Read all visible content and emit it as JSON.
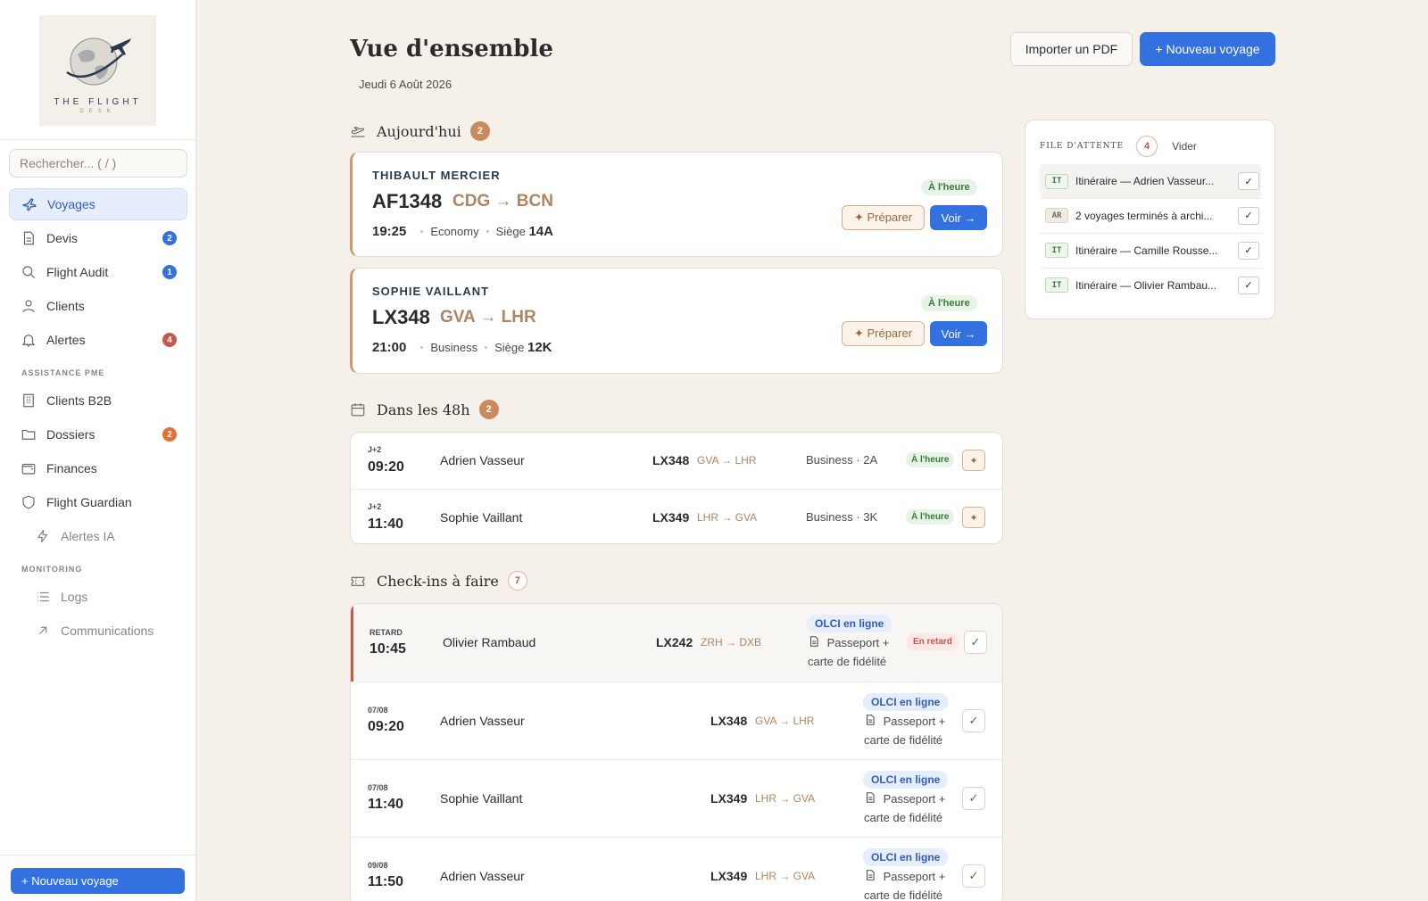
{
  "sidebar": {
    "logo": {
      "word1": "THE FLIGHT",
      "word2": "DESK"
    },
    "search_placeholder": "Rechercher...  ( / )",
    "nav": [
      {
        "label": "Voyages",
        "icon": "plane-icon",
        "badge": ""
      },
      {
        "label": "Devis",
        "icon": "document-icon",
        "badge": "2"
      },
      {
        "label": "Flight Audit",
        "icon": "search-icon",
        "badge": "1"
      },
      {
        "label": "Clients",
        "icon": "user-icon",
        "badge": ""
      },
      {
        "label": "Alertes",
        "icon": "bell-icon",
        "badge": "4"
      }
    ],
    "section_assistance": "ASSISTANCE PME",
    "nav2": [
      {
        "label": "Clients B2B",
        "icon": "building-icon",
        "badge": ""
      },
      {
        "label": "Dossiers",
        "icon": "folder-icon",
        "badge": "2"
      },
      {
        "label": "Finances",
        "icon": "wallet-icon",
        "badge": ""
      },
      {
        "label": "Flight Guardian",
        "icon": "shield-icon",
        "badge": ""
      },
      {
        "label": "Alertes IA",
        "icon": "bolt-icon",
        "badge": ""
      }
    ],
    "section_monitoring": "MONITORING",
    "nav3": [
      {
        "label": "Logs",
        "icon": "list-icon"
      },
      {
        "label": "Communications",
        "icon": "arrow-up-right-icon"
      }
    ],
    "footer_button": "+ Nouveau voyage"
  },
  "header": {
    "title": "Vue d'ensemble",
    "date": "Jeudi 6 Août 2026",
    "import_button": "Importer un PDF",
    "new_button": "+ Nouveau voyage"
  },
  "today": {
    "title": "Aujourd'hui",
    "count": "2",
    "flights": [
      {
        "passenger": "THIBAULT MERCIER",
        "flight": "AF1348",
        "route": "CDG → BCN",
        "time": "19:25",
        "cabin": "Economy",
        "seat_label": "Siège",
        "seat": "14A",
        "status": "À l'heure",
        "prepare": "✦ Préparer",
        "view": "Voir →"
      },
      {
        "passenger": "SOPHIE VAILLANT",
        "flight": "LX348",
        "route": "GVA → LHR",
        "time": "21:00",
        "cabin": "Business",
        "seat_label": "Siège",
        "seat": "12K",
        "status": "À l'heure",
        "prepare": "✦ Préparer",
        "view": "Voir →"
      }
    ]
  },
  "next48": {
    "title": "Dans les 48h",
    "count": "2",
    "rows": [
      {
        "day": "J+2",
        "time": "09:20",
        "name": "Adrien Vasseur",
        "flight": "LX348",
        "route": "GVA → LHR",
        "cabin": "Business · 2A",
        "status": "À l'heure",
        "action": "✦"
      },
      {
        "day": "J+2",
        "time": "11:40",
        "name": "Sophie Vaillant",
        "flight": "LX349",
        "route": "LHR → GVA",
        "cabin": "Business · 3K",
        "status": "À l'heure",
        "action": "✦"
      }
    ]
  },
  "checkins": {
    "title": "Check-ins à faire",
    "count": "7",
    "rows": [
      {
        "day": "RETARD",
        "time": "10:45",
        "name": "Olivier Rambaud",
        "flight": "LX242",
        "route": "ZRH → DXB",
        "olci": "OLCI en ligne",
        "doc1": "Passeport +",
        "doc2": "carte de fidélité",
        "late": "En retard",
        "check": "✓"
      },
      {
        "day": "07/08",
        "time": "09:20",
        "name": "Adrien Vasseur",
        "flight": "LX348",
        "route": "GVA → LHR",
        "olci": "OLCI en ligne",
        "doc1": "Passeport +",
        "doc2": "carte de fidélité",
        "check": "✓"
      },
      {
        "day": "07/08",
        "time": "11:40",
        "name": "Sophie Vaillant",
        "flight": "LX349",
        "route": "LHR → GVA",
        "olci": "OLCI en ligne",
        "doc1": "Passeport +",
        "doc2": "carte de fidélité",
        "check": "✓"
      },
      {
        "day": "09/08",
        "time": "11:50",
        "name": "Adrien Vasseur",
        "flight": "LX349",
        "route": "LHR → GVA",
        "olci": "OLCI en ligne",
        "doc1": "Passeport +",
        "doc2": "carte de fidélité",
        "check": "✓"
      }
    ]
  },
  "queue": {
    "title": "FILE D'ATTENTE",
    "count": "4",
    "clear": "Vider",
    "items": [
      {
        "tag": "IT",
        "text": "Itinéraire — Adrien Vasseur...",
        "check": "✓"
      },
      {
        "tag": "AR",
        "text": "2 voyages terminés à archi...",
        "check": "✓"
      },
      {
        "tag": "IT",
        "text": "Itinéraire — Camille Rousse...",
        "check": "✓"
      },
      {
        "tag": "IT",
        "text": "Itinéraire — Olivier Rambau...",
        "check": "✓"
      }
    ]
  },
  "colors": {
    "accent": "#3370e0",
    "gold": "#c98a5c",
    "late": "#c05a4a",
    "ok": "#3a7a3a"
  }
}
